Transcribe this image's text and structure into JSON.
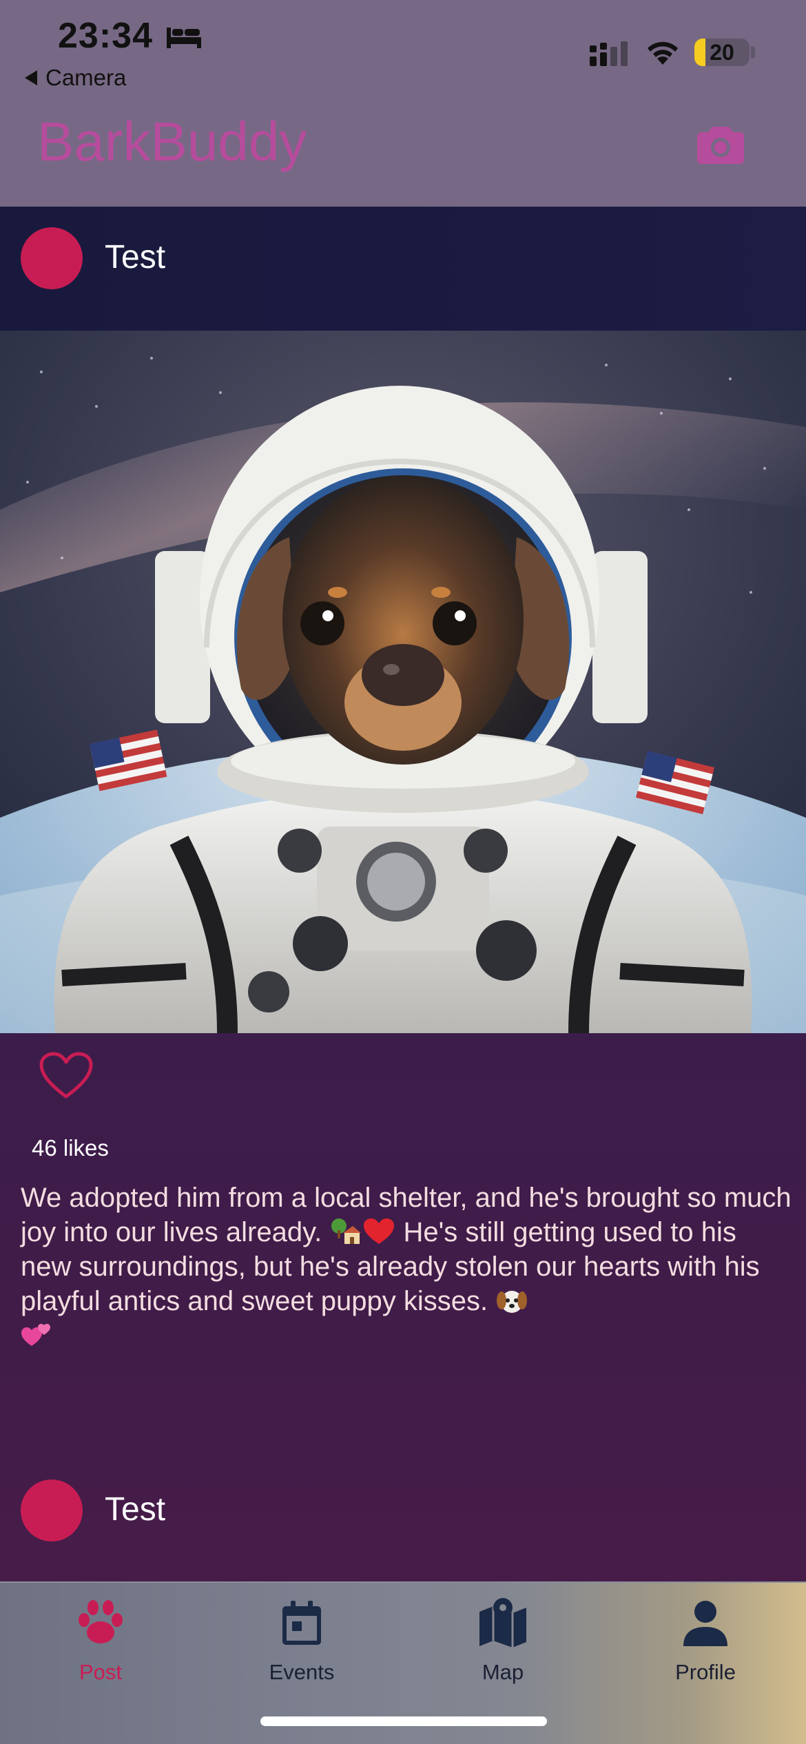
{
  "status_bar": {
    "time": "23:34",
    "back_label": "Camera",
    "battery_level": "20",
    "battery_fraction": 0.2
  },
  "header": {
    "app_title": "BarkBuddy",
    "camera_icon": "camera-icon"
  },
  "feed": {
    "posts": [
      {
        "username": "Test",
        "image_alt": "",
        "likes_label": "46 likes",
        "liked": false,
        "caption_1": "We adopted him from a local shelter, and he's brought so much joy into our lives already. ",
        "caption_2": " He's still getting used to his new surroundings, but he's already stolen our hearts with his playful antics and sweet puppy kisses. ",
        "caption_emoji_1": "house-with-tree-emoji",
        "caption_emoji_2": "red-heart-emoji",
        "caption_emoji_3": "dog-face-emoji",
        "caption_emoji_4": "two-hearts-emoji"
      },
      {
        "username": "Test"
      }
    ]
  },
  "tabs": [
    {
      "label": "Post",
      "icon": "paw-icon",
      "active": true
    },
    {
      "label": "Events",
      "icon": "calendar-icon",
      "active": false
    },
    {
      "label": "Map",
      "icon": "map-icon",
      "active": false
    },
    {
      "label": "Profile",
      "icon": "person-icon",
      "active": false
    }
  ],
  "colors": {
    "accent": "#c81d54",
    "header_bg": "#776985",
    "title": "#b64c9c",
    "post_header_bg": "#1c1c44",
    "tab_inactive": "#1b2033"
  }
}
